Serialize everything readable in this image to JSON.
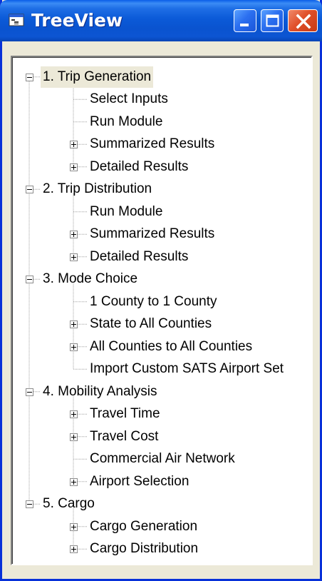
{
  "window": {
    "title": "TreeView"
  },
  "tree": [
    {
      "label": "1. Trip Generation",
      "children": [
        "Select Inputs",
        "Run Module",
        "Summarized Results",
        "Detailed Results"
      ]
    },
    {
      "label": "2. Trip Distribution",
      "children": [
        "Run Module",
        "Summarized Results",
        "Detailed Results"
      ]
    },
    {
      "label": "3. Mode Choice",
      "children": [
        "1 County to 1 County",
        "State to All Counties",
        "All Counties to All Counties",
        "Import Custom SATS Airport Set"
      ]
    },
    {
      "label": "4. Mobility Analysis",
      "children": [
        "Travel Time",
        "Travel Cost",
        "Commercial Air Network",
        "Airport Selection"
      ]
    },
    {
      "label": "5. Cargo",
      "children": [
        "Cargo Generation",
        "Cargo Distribution"
      ]
    }
  ],
  "selected_node": "1. Trip Generation"
}
